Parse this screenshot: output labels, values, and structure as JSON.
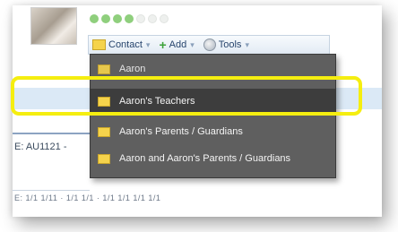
{
  "profile": {
    "avatar": "profile-photo"
  },
  "progress": {
    "filled": 4,
    "total": 7
  },
  "toolbar": {
    "contact_label": "Contact",
    "add_label": "Add",
    "tools_label": "Tools"
  },
  "menu": {
    "items": [
      {
        "label": "Aaron"
      },
      {
        "label": "Aaron's Teachers"
      },
      {
        "label": "Aaron's Parents / Guardians"
      },
      {
        "label": "Aaron and Aaron's Parents / Guardians"
      }
    ]
  },
  "record": {
    "id_fragment": "E: AU1121 -",
    "secondary_fragment": "E: 1/1 1/11 · 1/1 1/1 · 1/1 1/1 1/1 1/1"
  },
  "colors": {
    "highlight": "#f5ee10",
    "menu_bg": "#5f5f5f",
    "menu_active": "#3d3d3d",
    "progress_on": "#8fcf7d",
    "toolbar_text": "#27456d",
    "row_blue": "#dbe9f6"
  },
  "icons": {
    "contact": "envelope-icon",
    "add": "plus-icon",
    "tools": "tools-icon",
    "menu_item": "envelope-icon"
  }
}
